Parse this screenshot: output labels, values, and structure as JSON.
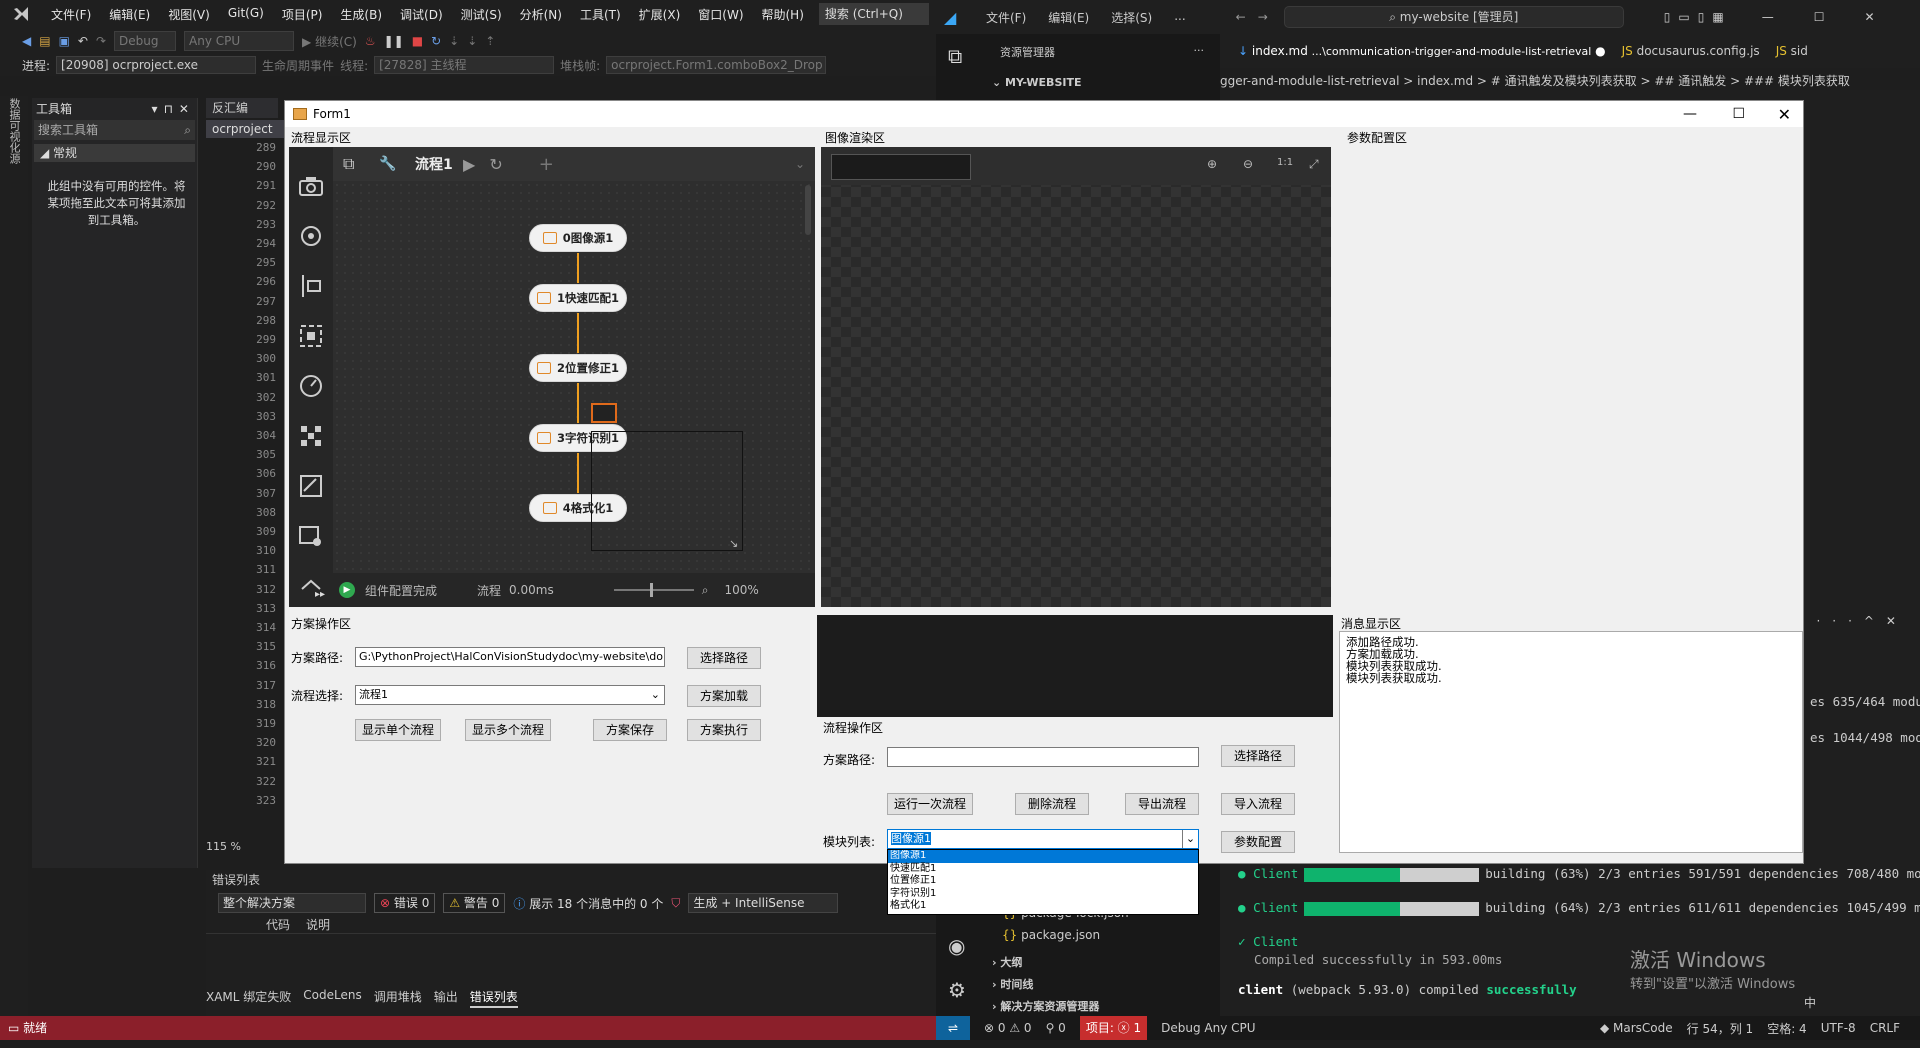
{
  "vs": {
    "menu": [
      "文件(F)",
      "编辑(E)",
      "视图(V)",
      "Git(G)",
      "项目(P)",
      "生成(B)",
      "调试(D)",
      "测试(S)",
      "分析(N)",
      "工具(T)",
      "扩展(X)",
      "窗口(W)",
      "帮助(H)"
    ],
    "search": "搜索 (Ctrl+Q)",
    "config": "Debug",
    "platform": "Any CPU",
    "continue": "继续(C)",
    "process_label": "进程:",
    "process": "[20908] ocrproject.exe",
    "lifecycle": "生命周期事件",
    "thread_label": "线程:",
    "thread": "[27828] 主线程",
    "stackframe_label": "堆栈帧:",
    "stackframe": "ocrproject.Form1.comboBox2_Drop",
    "toolbox_title": "工具箱",
    "toolbox_search": "搜索工具箱",
    "toolbox_group": "常规",
    "toolbox_empty": "此组中没有可用的控件。将某项拖至此文本可将其添加到工具箱。",
    "side_vertical": "数据可视化源",
    "doc_tab": "反汇编",
    "doc_file": "ocrproject",
    "line_numbers": [
      "289",
      "290",
      "291",
      "292",
      "293",
      "294",
      "295",
      "296",
      "297",
      "298",
      "299",
      "300",
      "301",
      "302",
      "303",
      "304",
      "305",
      "306",
      "307",
      "308",
      "309",
      "310",
      "311",
      "312",
      "313",
      "314",
      "315",
      "316",
      "317",
      "318",
      "319",
      "320",
      "321",
      "322",
      "323"
    ],
    "zoom": "115 %",
    "errors_title": "错误列表",
    "errors_scope": "整个解决方案",
    "errors_count": "错误 0",
    "warnings_count": "警告 0",
    "messages_text": "展示 18 个消息中的 0 个",
    "build_filter": "生成 + IntelliSense",
    "col_code": "代码",
    "col_desc": "说明",
    "bottom_tabs": [
      "XAML 绑定失败",
      "CodeLens",
      "调用堆栈",
      "输出",
      "错误列表"
    ],
    "status_ready": "就绪"
  },
  "form": {
    "title": "Form1",
    "section_flow_display": "流程显示区",
    "section_image": "图像渲染区",
    "section_params": "参数配置区",
    "section_messages": "消息显示区",
    "section_scheme_ops": "方案操作区",
    "section_flow_ops": "流程操作区",
    "flow_tab": "流程1",
    "nodes": [
      "0图像源1",
      "1快速匹配1",
      "2位置修正1",
      "3字符识别1",
      "4格式化1"
    ],
    "status_text": "组件配置完成",
    "status_flow": "流程",
    "status_time": "0.00ms",
    "status_zoom": "100%",
    "scheme_path_label": "方案路径:",
    "scheme_path_value": "G:\\PythonProject\\HalConVisionStudydoc\\my-website\\do",
    "select_path_btn": "选择路径",
    "flow_select_label": "流程选择:",
    "flow_select_value": "流程1",
    "load_scheme_btn": "方案加载",
    "show_single_btn": "显示单个流程",
    "show_multi_btn": "显示多个流程",
    "save_scheme_btn": "方案保存",
    "exec_scheme_btn": "方案执行",
    "flow_path_label": "方案路径:",
    "flow_path_value": "",
    "flow_select_path_btn": "选择路径",
    "run_once_btn": "运行一次流程",
    "delete_flow_btn": "删除流程",
    "export_flow_btn": "导出流程",
    "import_flow_btn": "导入流程",
    "module_list_label": "模块列表:",
    "module_selected": "图像源1",
    "module_options": [
      "图像源1",
      "快速匹配1",
      "位置修正1",
      "字符识别1",
      "格式化1"
    ],
    "param_config_btn": "参数配置",
    "messages": [
      "添加路径成功.",
      "方案加载成功.",
      "模块列表获取成功.",
      "模块列表获取成功."
    ]
  },
  "vscode": {
    "menu": [
      "文件(F)",
      "编辑(E)",
      "选择(S)",
      "..."
    ],
    "search": "my-website [管理员]",
    "explorer_title": "资源管理器",
    "project": "MY-WEBSITE",
    "tab_active": "index.md",
    "tab_active_path": "...\\communication-trigger-and-module-list-retrieval",
    "tab2": "docusaurus.config.js",
    "tab3": "sid",
    "breadcrumb": "gger-and-module-list-retrieval > index.md > # 通讯触发及模块列表获取 > ## 通讯触发 > ### 模块列表获取",
    "files": [
      "package-lock.json",
      "package.json"
    ],
    "sections": [
      "大纲",
      "时间线",
      "解决方案资源管理器"
    ],
    "terminal_partial": [
      "es 635/464 modu",
      "es 1044/498 mod"
    ],
    "build_lines": [
      {
        "name": "Client",
        "status": "building (63%)",
        "detail": "2/3 entries 591/591 dependencies 708/480 modu",
        "progress": 0.55
      },
      {
        "name": "Client",
        "status": "building (64%)",
        "detail": "2/3 entries 611/611 dependencies 1045/499 mod",
        "progress": 0.55
      }
    ],
    "compiled_name": "Client",
    "compiled_msg": "Compiled successfully in 593.00ms",
    "client_line_a": "client",
    "client_line_b": "(webpack 5.93.0) compiled",
    "client_line_c": "successfully",
    "watermark1": "激活 Windows",
    "watermark2": "转到\"设置\"以激活 Windows",
    "status_errors": "0",
    "status_warnings": "0",
    "status_ports": "0",
    "status_project": "项目: ⓧ 1",
    "status_debug": "Debug Any CPU",
    "status_marscode": "MarsCode",
    "status_pos": "行 54，列 1",
    "status_spaces": "空格: 4",
    "status_enc": "UTF-8",
    "status_eol": "CRLF",
    "ime": "中"
  },
  "colors": {
    "vs_bg": "#1f1f1f",
    "accent": "#0e639c",
    "status_red": "#8b1f2a",
    "node_orange": "#f0a020",
    "term_green": "#0fb36d"
  }
}
